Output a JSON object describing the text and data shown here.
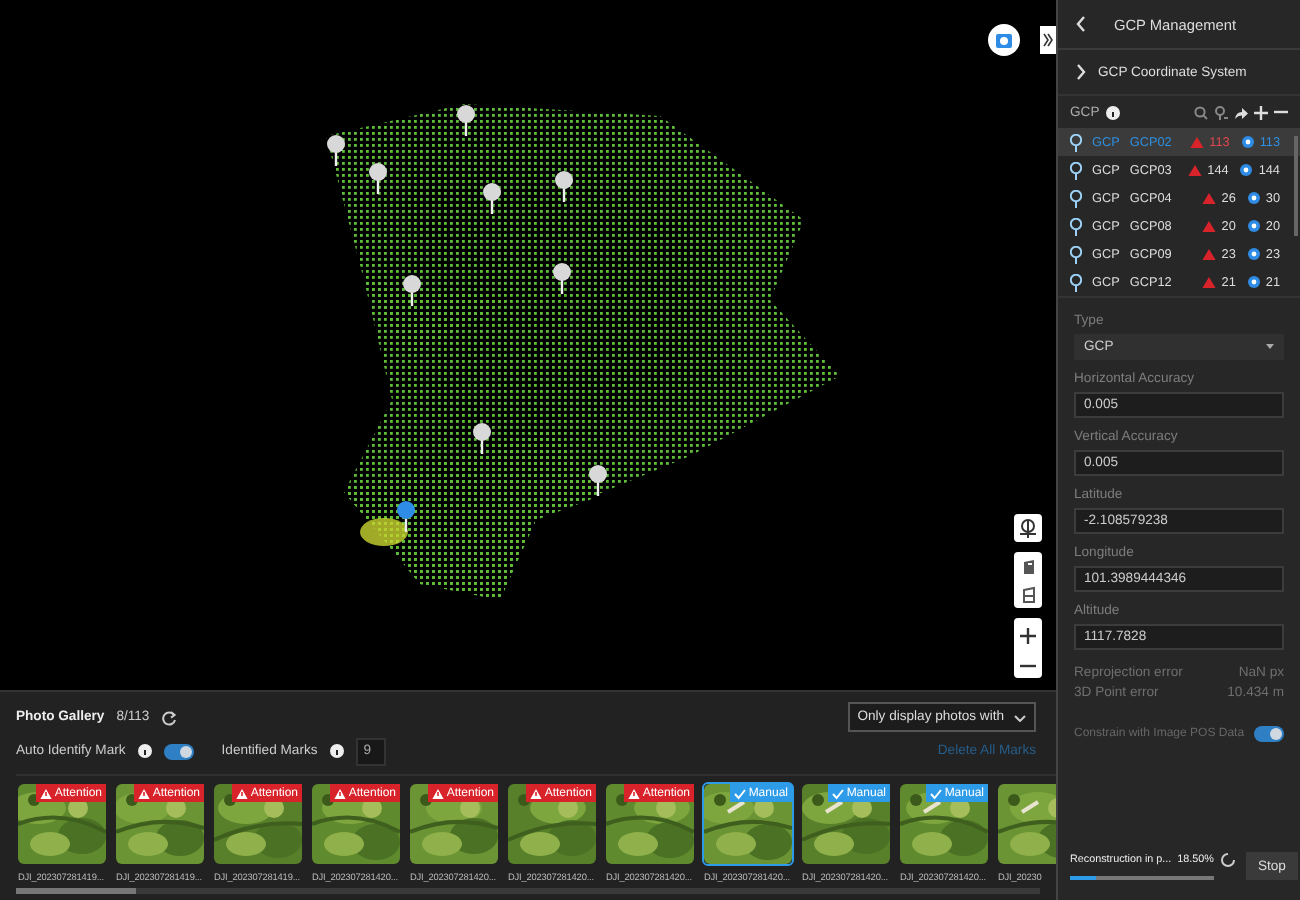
{
  "panel": {
    "title": "GCP Management",
    "section": "GCP Coordinate System",
    "list_label": "GCP",
    "gcps": [
      {
        "type": "GCP",
        "name": "GCP02",
        "warnings": "113",
        "marks": "113",
        "selected": true
      },
      {
        "type": "GCP",
        "name": "GCP03",
        "warnings": "144",
        "marks": "144",
        "selected": false
      },
      {
        "type": "GCP",
        "name": "GCP04",
        "warnings": "26",
        "marks": "30",
        "selected": false
      },
      {
        "type": "GCP",
        "name": "GCP08",
        "warnings": "20",
        "marks": "20",
        "selected": false
      },
      {
        "type": "GCP",
        "name": "GCP09",
        "warnings": "23",
        "marks": "23",
        "selected": false
      },
      {
        "type": "GCP",
        "name": "GCP12",
        "warnings": "21",
        "marks": "21",
        "selected": false
      }
    ],
    "type_field": {
      "label": "Type",
      "value": "GCP"
    },
    "fields": [
      {
        "label": "Horizontal Accuracy",
        "value": "0.005"
      },
      {
        "label": "Vertical Accuracy",
        "value": "0.005"
      },
      {
        "label": "Latitude",
        "value": "-2.108579238"
      },
      {
        "label": "Longitude",
        "value": "101.3989444346"
      },
      {
        "label": "Altitude",
        "value": "1117.7828"
      }
    ],
    "errors": [
      {
        "label": "Reprojection error",
        "value": "NaN px"
      },
      {
        "label": "3D Point error",
        "value": "10.434 m"
      }
    ],
    "constrain": {
      "label": "Constrain with Image POS Data",
      "on": true
    },
    "progress": {
      "label": "Reconstruction in p...",
      "reading": "18.50%",
      "level": 0.185
    },
    "stop_button": "Stop"
  },
  "gallery": {
    "title": "Photo Gallery",
    "count": "8/113",
    "filter": "Only display photos with",
    "auto_identify": {
      "label": "Auto Identify Mark",
      "on": true
    },
    "identified": {
      "label": "Identified Marks",
      "value": "9"
    },
    "delete_link": "Delete All Marks",
    "photos": [
      {
        "name": "DJI_202307281419...",
        "kind": "attention",
        "badge_label": "Attention",
        "selected": false
      },
      {
        "name": "DJI_202307281419...",
        "kind": "attention",
        "badge_label": "Attention",
        "selected": false
      },
      {
        "name": "DJI_202307281419...",
        "kind": "attention",
        "badge_label": "Attention",
        "selected": false
      },
      {
        "name": "DJI_202307281420...",
        "kind": "attention",
        "badge_label": "Attention",
        "selected": false
      },
      {
        "name": "DJI_202307281420...",
        "kind": "attention",
        "badge_label": "Attention",
        "selected": false
      },
      {
        "name": "DJI_202307281420...",
        "kind": "attention",
        "badge_label": "Attention",
        "selected": false
      },
      {
        "name": "DJI_202307281420...",
        "kind": "attention",
        "badge_label": "Attention",
        "selected": false
      },
      {
        "name": "DJI_202307281420...",
        "kind": "manual",
        "badge_label": "Manual",
        "selected": true
      },
      {
        "name": "DJI_202307281420...",
        "kind": "manual",
        "badge_label": "Manual",
        "selected": false
      },
      {
        "name": "DJI_202307281420...",
        "kind": "manual",
        "badge_label": "Manual",
        "selected": false
      },
      {
        "name": "DJI_20230",
        "kind": "plain",
        "selected": false
      }
    ]
  }
}
